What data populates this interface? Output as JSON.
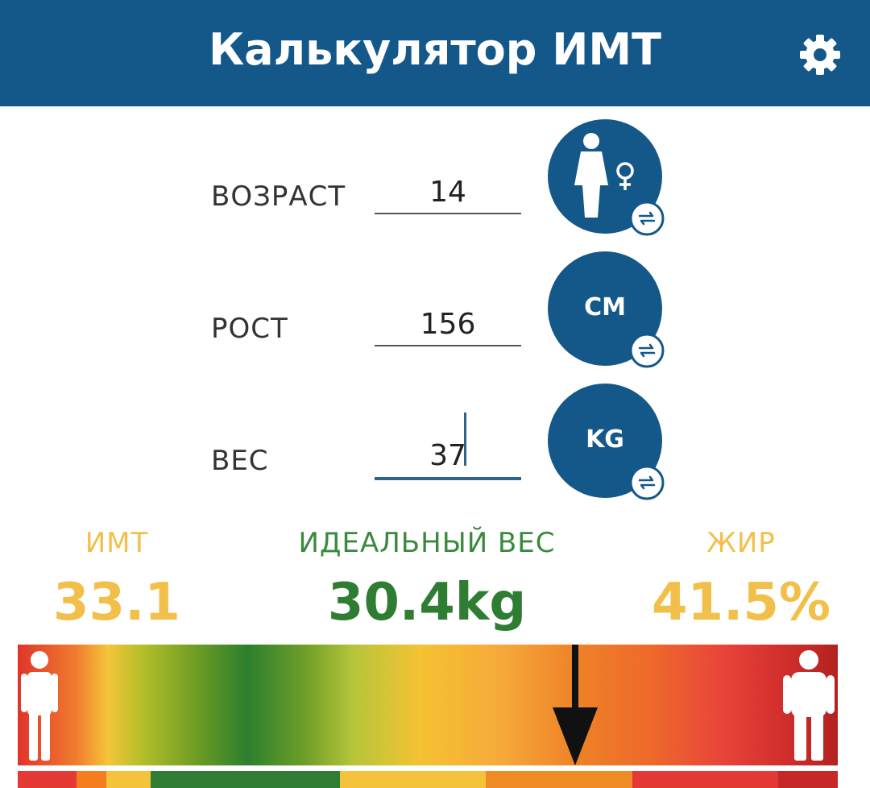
{
  "header": {
    "title": "Калькулятор ИМТ",
    "settings_icon": "gear-icon"
  },
  "form": {
    "age": {
      "label": "ВОЗРАСТ",
      "value": "14",
      "gender_icon": "female-icon"
    },
    "height": {
      "label": "РОСТ",
      "value": "156",
      "unit": "CM"
    },
    "weight": {
      "label": "ВЕС",
      "value": "37",
      "unit": "KG"
    },
    "swap_icon": "swap-arrows-icon"
  },
  "results": {
    "bmi": {
      "label": "ИМТ",
      "value": "33.1",
      "color": "#f2c04a"
    },
    "ideal_weight": {
      "label": "ИДЕАЛЬНЫЙ ВЕС",
      "value": "30.4kg",
      "color": "#2e7d32"
    },
    "fat": {
      "label": "ЖИР",
      "value": "41.5%",
      "color": "#f2c04a"
    }
  },
  "scale": {
    "indicator_fraction": 0.68,
    "left_icon": "thin-person-icon",
    "right_icon": "heavy-person-icon",
    "segment_colors": [
      "#e53935",
      "#f57c1f",
      "#f5c33b",
      "#2e7d32",
      "#f5c33b",
      "#f08c28",
      "#e53935",
      "#c62828"
    ]
  },
  "colors": {
    "primary": "#14588a",
    "label_text": "#333333"
  }
}
